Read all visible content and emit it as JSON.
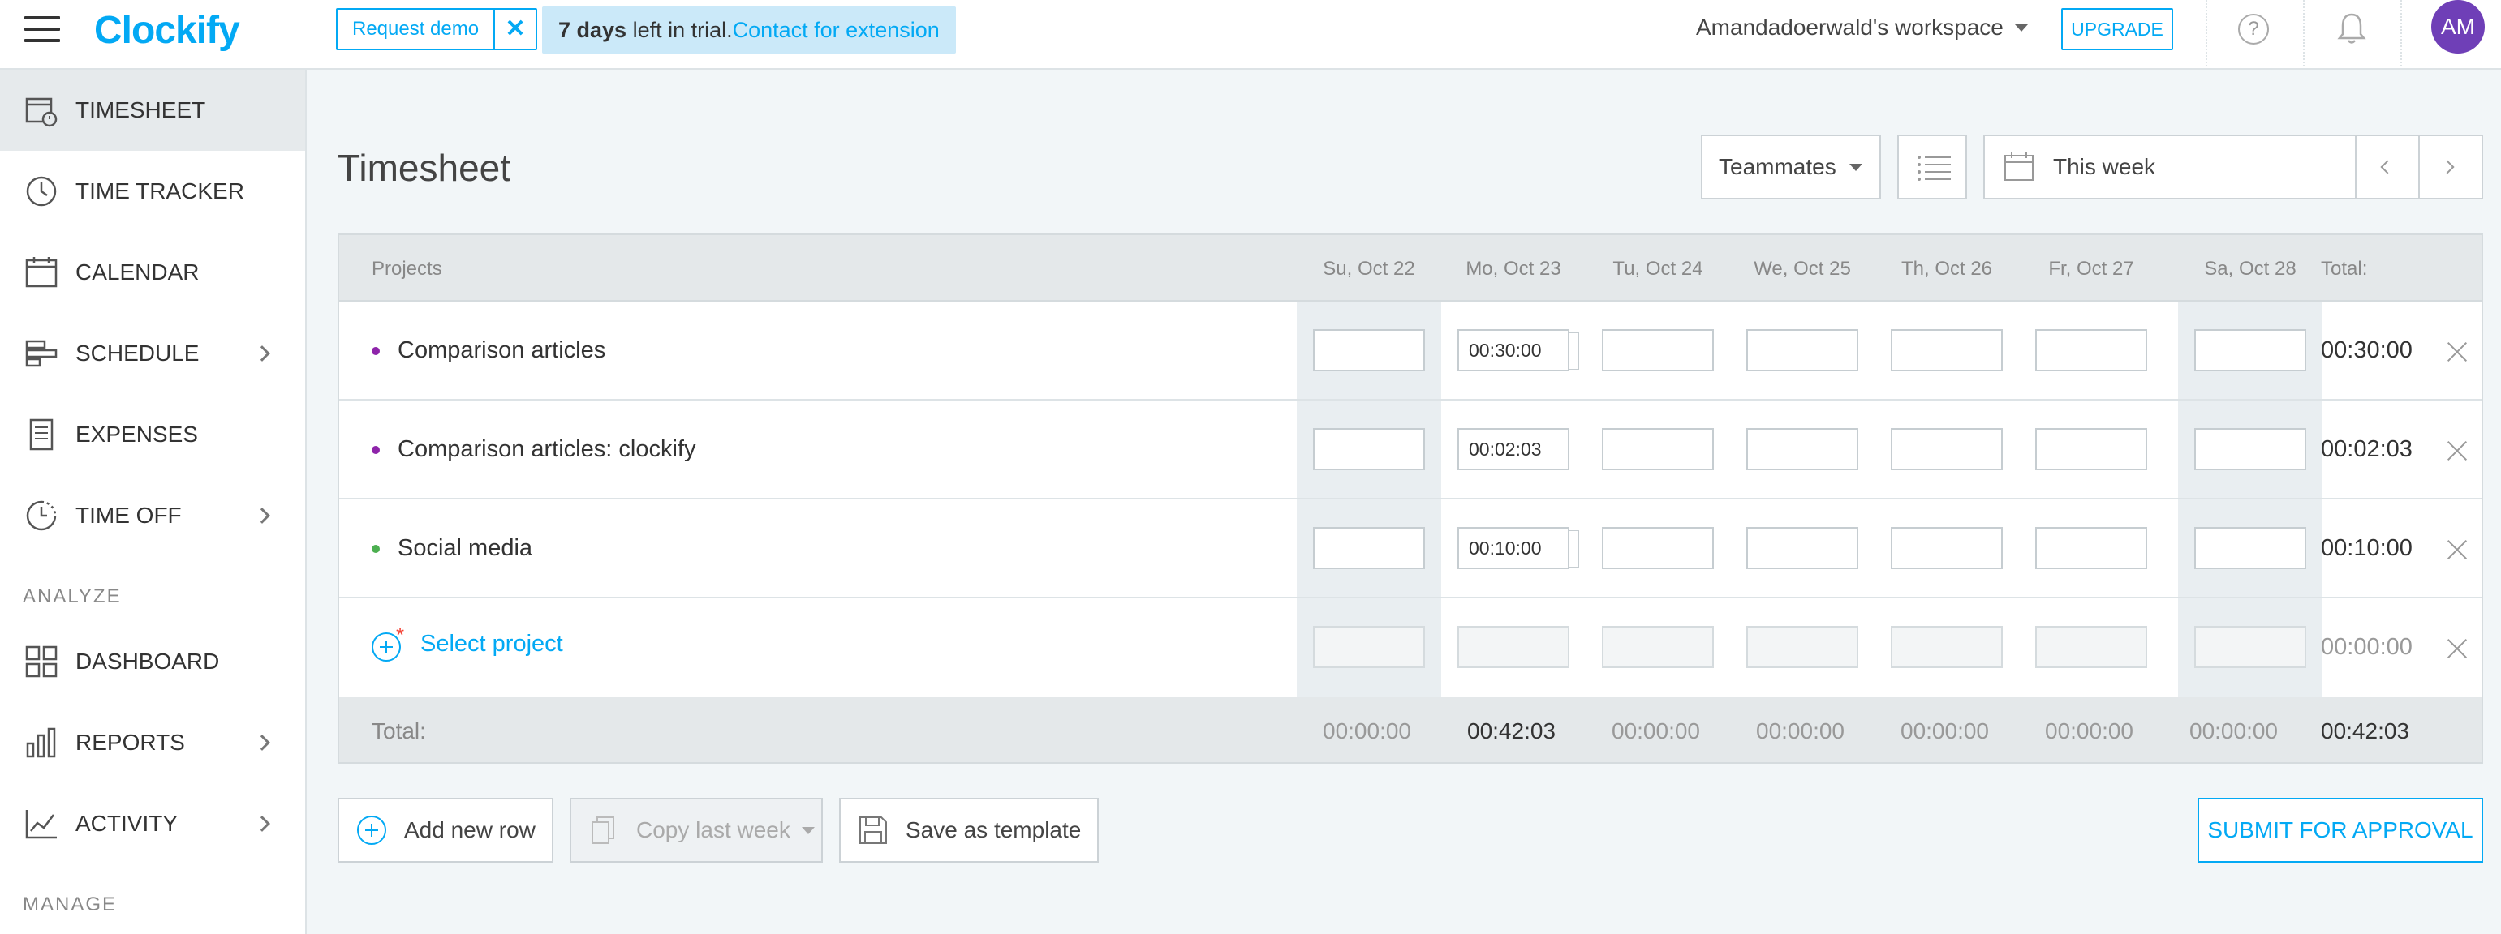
{
  "header": {
    "logo": "Clockify",
    "request_demo": "Request demo",
    "trial_days": "7 days",
    "trial_mid": " left in trial.",
    "trial_link": "Contact for extension",
    "workspace": "Amandadoerwald's workspace",
    "upgrade": "UPGRADE",
    "avatar_initials": "AM",
    "accent_color": "#03a9f4",
    "avatar_color": "#6f3fb7"
  },
  "sidebar": {
    "items": [
      {
        "label": "TIMESHEET",
        "icon": "timesheet-icon",
        "active": true
      },
      {
        "label": "TIME TRACKER",
        "icon": "clock-icon"
      },
      {
        "label": "CALENDAR",
        "icon": "calendar-icon"
      },
      {
        "label": "SCHEDULE",
        "icon": "schedule-icon",
        "expandable": true
      },
      {
        "label": "EXPENSES",
        "icon": "receipt-icon"
      },
      {
        "label": "TIME OFF",
        "icon": "time-off-icon",
        "expandable": true
      },
      {
        "label": "DASHBOARD",
        "icon": "dashboard-icon"
      },
      {
        "label": "REPORTS",
        "icon": "reports-icon",
        "expandable": true
      },
      {
        "label": "ACTIVITY",
        "icon": "activity-icon",
        "expandable": true
      }
    ],
    "section_analyze": "ANALYZE",
    "section_manage": "MANAGE"
  },
  "main": {
    "title": "Timesheet",
    "teammates": "Teammates",
    "week_label": "This week",
    "columns": {
      "projects": "Projects",
      "days": [
        "Su, Oct 22",
        "Mo, Oct 23",
        "Tu, Oct 24",
        "We, Oct 25",
        "Th, Oct 26",
        "Fr, Oct 27",
        "Sa, Oct 28"
      ],
      "total": "Total:"
    },
    "rows": [
      {
        "project": "Comparison articles",
        "color": "#8e24aa",
        "values": [
          "",
          "00:30:00",
          "",
          "",
          "",
          "",
          ""
        ],
        "total": "00:30:00"
      },
      {
        "project": "Comparison articles: clockify",
        "color": "#8e24aa",
        "values": [
          "",
          "00:02:03",
          "",
          "",
          "",
          "",
          ""
        ],
        "total": "00:02:03"
      },
      {
        "project": "Social media",
        "color": "#4caf50",
        "values": [
          "",
          "00:10:00",
          "",
          "",
          "",
          "",
          ""
        ],
        "total": "00:10:00"
      }
    ],
    "new_row": {
      "placeholder": "Select project",
      "total": "00:00:00"
    },
    "footer": {
      "label": "Total:",
      "days": [
        "00:00:00",
        "00:42:03",
        "00:00:00",
        "00:00:00",
        "00:00:00",
        "00:00:00",
        "00:00:00"
      ],
      "total": "00:42:03"
    },
    "buttons": {
      "add_row": "Add new row",
      "copy_last_week": "Copy last week",
      "save_template": "Save as template",
      "submit": "SUBMIT FOR APPROVAL"
    }
  }
}
